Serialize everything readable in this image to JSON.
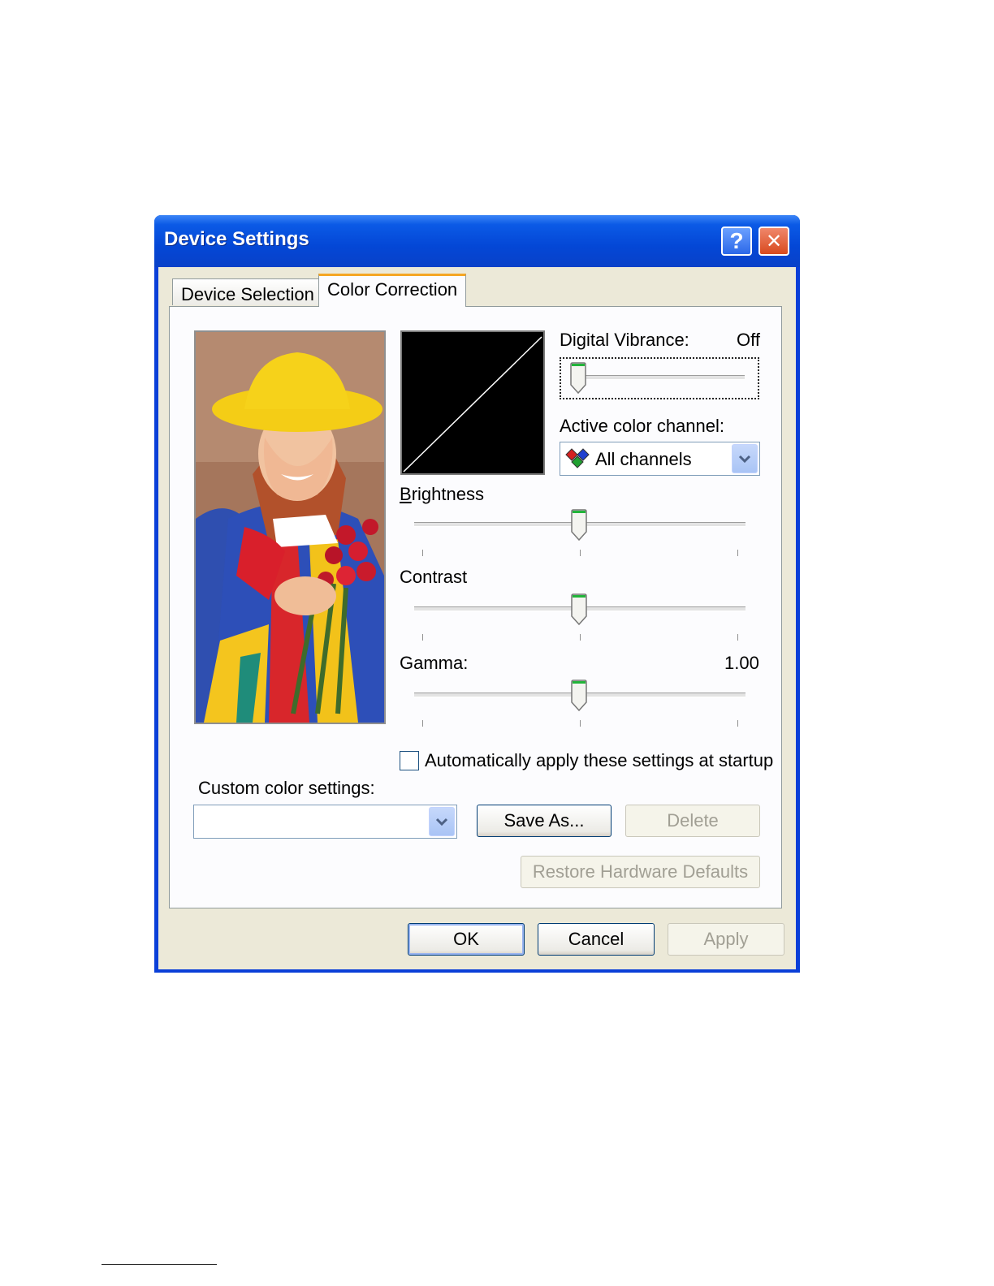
{
  "window": {
    "title": "Device Settings",
    "help_glyph": "?",
    "close_glyph": "✕"
  },
  "tabs": [
    {
      "label": "Device Selection",
      "active": false
    },
    {
      "label": "Color Correction",
      "active": true
    }
  ],
  "digital_vibrance": {
    "label": "Digital Vibrance:",
    "value": "Off",
    "level": 0.0
  },
  "active_channel": {
    "label": "Active color channel:",
    "value": "All channels"
  },
  "brightness": {
    "label": "Brightness",
    "level": 0.5
  },
  "contrast": {
    "label": "Contrast",
    "level": 0.5
  },
  "gamma": {
    "label": "Gamma:",
    "value": "1.00",
    "level": 0.5
  },
  "auto_apply": {
    "label": "Automatically apply these settings at startup",
    "checked": false
  },
  "custom_settings": {
    "label": "Custom color settings:",
    "value": ""
  },
  "buttons": {
    "save_as": "Save As...",
    "delete": "Delete",
    "restore": "Restore Hardware Defaults",
    "ok": "OK",
    "cancel": "Cancel",
    "apply": "Apply"
  },
  "colors": {
    "titlebar": "#0447d6",
    "face": "#ece9d8",
    "tab_accent": "#f5a623"
  },
  "icons": [
    "help-icon",
    "close-icon",
    "color-channel-icon",
    "chevron-down-icon",
    "slider-thumb-icon"
  ]
}
